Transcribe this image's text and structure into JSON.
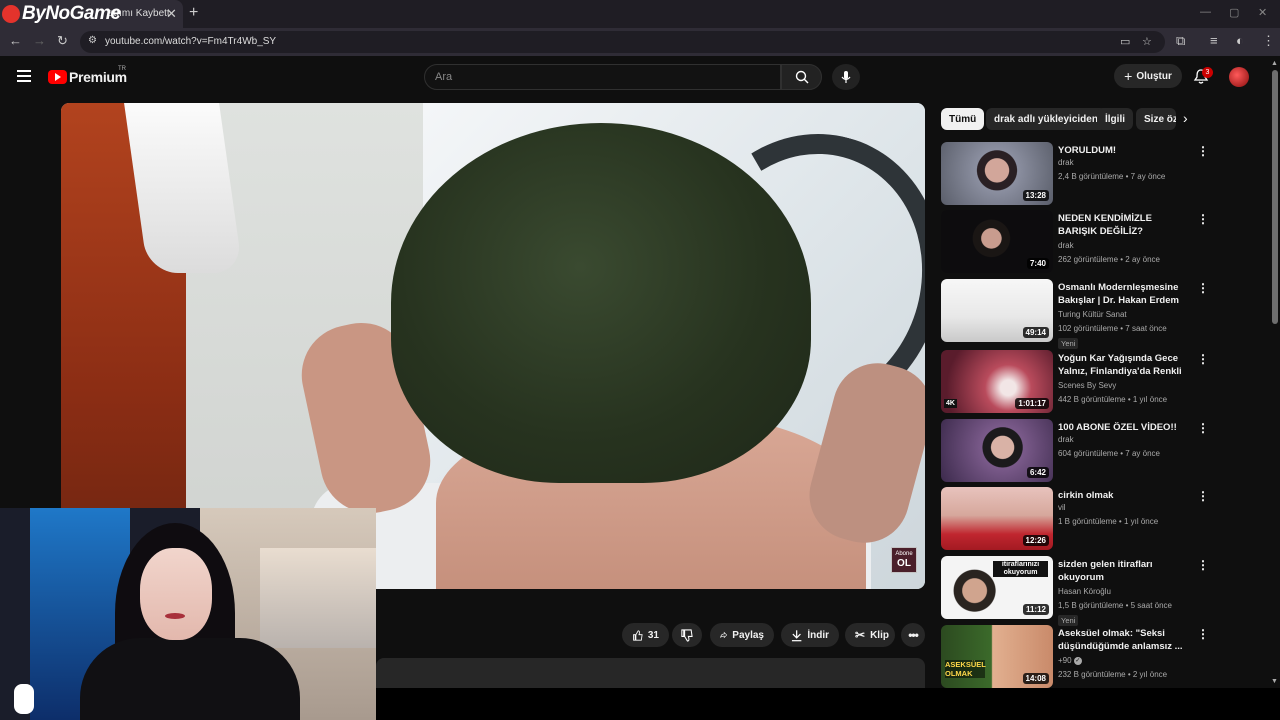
{
  "browser": {
    "tab_title": "attımı Kaybett",
    "overlay_logo": "ByNoGame",
    "url": "youtube.com/watch?v=Fm4Tr4Wb_SY"
  },
  "youtube": {
    "logo_text": "Premium",
    "region": "TR",
    "search_placeholder": "Ara",
    "create_label": "Oluştur",
    "notification_count": "3"
  },
  "video": {
    "overlay_badge_top": "Abone",
    "overlay_badge_bottom": "OL"
  },
  "actions": {
    "likes": "31",
    "share": "Paylaş",
    "download": "İndir",
    "clip": "Klip"
  },
  "chips": [
    "Tümü",
    "drak adlı yükleyiciden",
    "İlgili",
    "Size öz"
  ],
  "recommendations": [
    {
      "title": "YORULDUM!",
      "channel": "drak",
      "stats": "2,4 B görüntüleme • 7 ay önce",
      "duration": "13:28",
      "new": ""
    },
    {
      "title": "NEDEN KENDİMİZLE BARIŞIK DEĞİLİZ?",
      "channel": "drak",
      "stats": "262 görüntüleme • 2 ay önce",
      "duration": "7:40",
      "new": ""
    },
    {
      "title": "Osmanlı Modernleşmesine Bakışlar | Dr. Hakan Erdem",
      "channel": "Turing Kültür Sanat",
      "stats": "102 görüntüleme • 7 saat önce",
      "duration": "49:14",
      "new": "Yeni"
    },
    {
      "title": "Yoğun Kar Yağışında Gece Yalnız, Finlandiya'da Renkli ...",
      "channel": "Scenes By Sevy",
      "stats": "442 B görüntüleme • 1 yıl önce",
      "duration": "1:01:17",
      "new": ""
    },
    {
      "title": "100 ABONE ÖZEL VİDEO!!",
      "channel": "drak",
      "stats": "604 görüntüleme • 7 ay önce",
      "duration": "6:42",
      "new": ""
    },
    {
      "title": "cirkin olmak",
      "channel": "vil",
      "stats": "1 B görüntüleme • 1 yıl önce",
      "duration": "12:26",
      "new": ""
    },
    {
      "title": "sizden gelen itirafları okuyorum",
      "channel": "Hasan Köroğlu",
      "stats": "1,5 B görüntüleme • 5 saat önce",
      "duration": "11:12",
      "new": "Yeni"
    },
    {
      "title": "Aseksüel olmak: \"Seksi düşündüğümde anlamsız ...",
      "channel": "+90",
      "stats": "232 B görüntüleme • 2 yıl önce",
      "duration": "14:08",
      "new": ""
    }
  ],
  "thumb_texts": {
    "rec4_badge": "4K",
    "rec7_thumb": "itiraflarınızı okuyorum",
    "rec8_thumb": "ASEKSÜEL OLMAK"
  },
  "colors": {
    "accent": "#ff0000",
    "background": "#0f0f0f",
    "surface": "#272727"
  }
}
